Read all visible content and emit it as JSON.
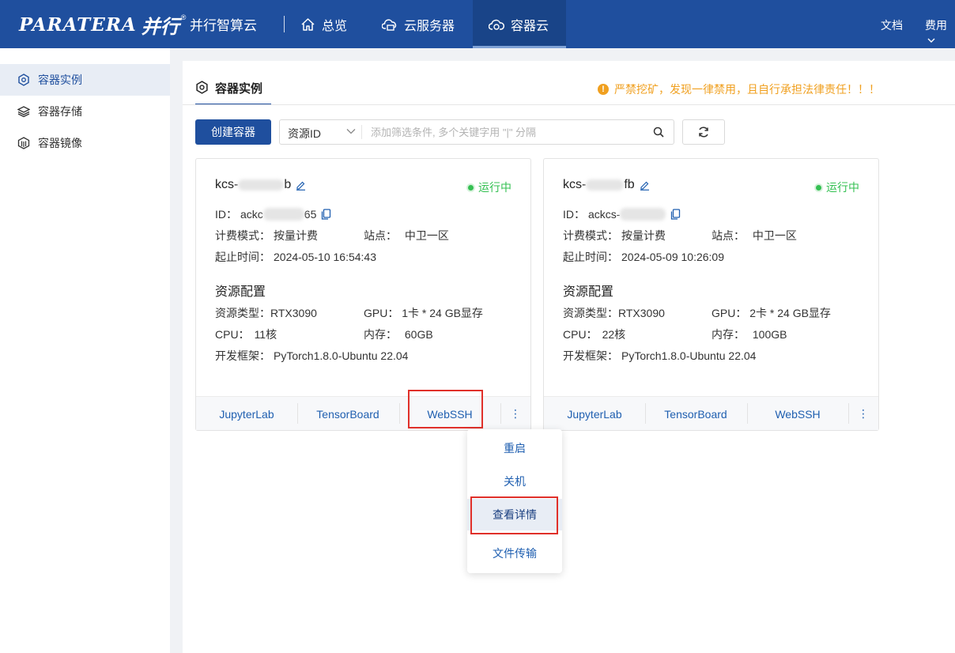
{
  "header": {
    "logo_en": "PARATERA",
    "logo_cn": "并行",
    "logo_reg": "®",
    "brand": "并行智算云",
    "nav": [
      {
        "label": "总览",
        "icon": "home-icon"
      },
      {
        "label": "云服务器",
        "icon": "cloud-server-icon"
      },
      {
        "label": "容器云",
        "icon": "cloud-container-icon",
        "active": true
      }
    ],
    "right": [
      "文档",
      "费用"
    ]
  },
  "sidebar": {
    "items": [
      {
        "label": "容器实例",
        "icon": "container-instance-icon",
        "active": true
      },
      {
        "label": "容器存储",
        "icon": "layers-icon"
      },
      {
        "label": "容器镜像",
        "icon": "image-icon"
      }
    ]
  },
  "main": {
    "tab": "容器实例",
    "warning": "严禁挖矿，发现一律禁用，且自行承担法律责任！！！",
    "create_button": "创建容器",
    "filter": {
      "select_value": "资源ID",
      "placeholder": "添加筛选条件, 多个关键字用 \"|\" 分隔"
    }
  },
  "cards": [
    {
      "name_prefix": "kcs-",
      "name_suffix": "b",
      "status": "运行中",
      "id_label": "ID：",
      "id_prefix": "ackc",
      "id_suffix": "65",
      "billing_label": "计费模式：",
      "billing": "按量计费",
      "site_label": "站点：",
      "site": "中卫一区",
      "time_label": "起止时间：",
      "time": "2024-05-10 16:54:43",
      "resource_title": "资源配置",
      "type_label": "资源类型：",
      "type": "RTX3090",
      "gpu_label": "GPU：",
      "gpu": "1卡 * 24 GB显存",
      "cpu_label": "CPU：",
      "cpu": "11核",
      "mem_label": "内存：",
      "mem": "60GB",
      "framework_label": "开发框架：",
      "framework": "PyTorch1.8.0-Ubuntu 22.04",
      "links": [
        "JupyterLab",
        "TensorBoard",
        "WebSSH"
      ],
      "more": "⋮"
    },
    {
      "name_prefix": "kcs-",
      "name_suffix": "fb",
      "status": "运行中",
      "id_label": "ID：",
      "id_prefix": "ackcs-",
      "id_suffix": "",
      "billing_label": "计费模式：",
      "billing": "按量计费",
      "site_label": "站点：",
      "site": "中卫一区",
      "time_label": "起止时间：",
      "time": "2024-05-09 10:26:09",
      "resource_title": "资源配置",
      "type_label": "资源类型：",
      "type": "RTX3090",
      "gpu_label": "GPU：",
      "gpu": "2卡 * 24 GB显存",
      "cpu_label": "CPU：",
      "cpu": "22核",
      "mem_label": "内存：",
      "mem": "100GB",
      "framework_label": "开发框架：",
      "framework": "PyTorch1.8.0-Ubuntu 22.04",
      "links": [
        "JupyterLab",
        "TensorBoard",
        "WebSSH"
      ],
      "more": "⋮"
    }
  ],
  "dropdown": {
    "items": [
      "重启",
      "关机",
      "查看详情",
      "文件传输"
    ],
    "hovered": "查看详情"
  },
  "colors": {
    "brand": "#1f4f9e",
    "link": "#1f5fb0",
    "running": "#34c052",
    "warning": "#f0a020",
    "highlight": "#e0302a"
  }
}
